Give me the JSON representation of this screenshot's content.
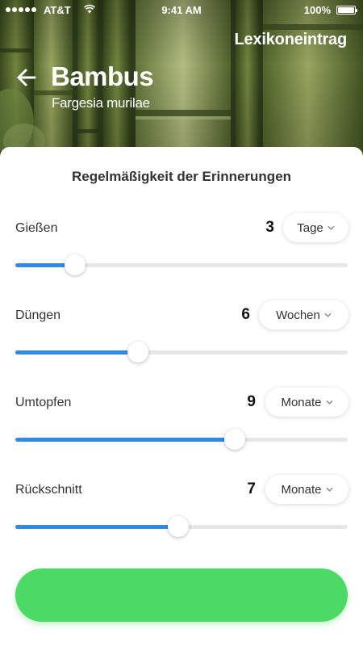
{
  "status_bar": {
    "carrier": "AT&T",
    "time": "9:41 AM",
    "battery": "100%",
    "icons": [
      "signal-dots",
      "wifi-icon",
      "battery-icon"
    ]
  },
  "header": {
    "link_label": "Lexikoneintrag",
    "back_icon": "arrow-left-icon",
    "plant_name": "Bambus",
    "plant_species": "Fargesia murilae"
  },
  "reminders": {
    "title": "Regelmäßigkeit der Erinnerungen",
    "items": [
      {
        "label": "Gießen",
        "value": "3",
        "unit": "Tage",
        "slider_fraction": 0.18
      },
      {
        "label": "Düngen",
        "value": "6",
        "unit": "Wochen",
        "slider_fraction": 0.37
      },
      {
        "label": "Umtopfen",
        "value": "9",
        "unit": "Monate",
        "slider_fraction": 0.66
      },
      {
        "label": "Rückschnitt",
        "value": "7",
        "unit": "Monate",
        "slider_fraction": 0.49
      }
    ]
  },
  "primary_button": {
    "label": ""
  },
  "colors": {
    "accent": "#2f8ae8",
    "button_green": "#4cd964",
    "track": "#e7e7e7",
    "text_dark": "#333333"
  }
}
